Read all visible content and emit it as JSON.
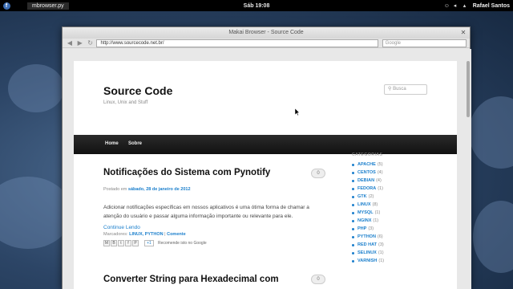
{
  "top_panel": {
    "activities_glyph": "f",
    "app_name": "mbrowser.py",
    "clock": "Sáb 19:08",
    "user": "Rafael Santos"
  },
  "window": {
    "title": "Makai Browser - Source Code",
    "url": "http://www.sourcecode.net.br/",
    "search_placeholder": "Google"
  },
  "site": {
    "title": "Source Code",
    "description": "Linux, Unix and Stuff",
    "search_placeholder": "Busca",
    "nav": [
      "Home",
      "Sobre"
    ]
  },
  "posts": [
    {
      "title": "Notificações do Sistema com Pynotify",
      "comments": "0",
      "meta_prefix": "Postado em",
      "date": "sábado, 28 de janeiro de 2012",
      "body": "Adicionar notificações específicas em nossos aplicativos é uma ótima forma de chamar a atenção do usuário e passar alguma informação importante ou relevante para ele.",
      "continue": "Continue Lendo",
      "markers_prefix": "Marcadores:",
      "markers": "LINUX, PYTHON",
      "comment_link": "Comente",
      "recommend": "Recomende isto no Google"
    },
    {
      "title": "Converter String para Hexadecimal com",
      "comments": "0"
    }
  ],
  "sidebar": {
    "heading": "CATEGORIAS",
    "categories": [
      {
        "name": "APACHE",
        "count": "(5)"
      },
      {
        "name": "CENTOS",
        "count": "(4)"
      },
      {
        "name": "DEBIAN",
        "count": "(4)"
      },
      {
        "name": "FEDORA",
        "count": "(1)"
      },
      {
        "name": "GTK",
        "count": "(2)"
      },
      {
        "name": "LINUX",
        "count": "(8)"
      },
      {
        "name": "MYSQL",
        "count": "(1)"
      },
      {
        "name": "NGINX",
        "count": "(1)"
      },
      {
        "name": "PHP",
        "count": "(3)"
      },
      {
        "name": "PYTHON",
        "count": "(6)"
      },
      {
        "name": "RED HAT",
        "count": "(3)"
      },
      {
        "name": "SELINUX",
        "count": "(1)"
      },
      {
        "name": "VARNISH",
        "count": "(1)"
      }
    ]
  },
  "icons": {
    "back": "back-arrow-icon",
    "forward": "forward-arrow-icon",
    "reload": "reload-icon",
    "close": "close-icon",
    "search": "search-icon"
  },
  "colors": {
    "link": "#1b7fcc",
    "navbar": "#1a1a1a",
    "desktop": "#2c4566"
  }
}
